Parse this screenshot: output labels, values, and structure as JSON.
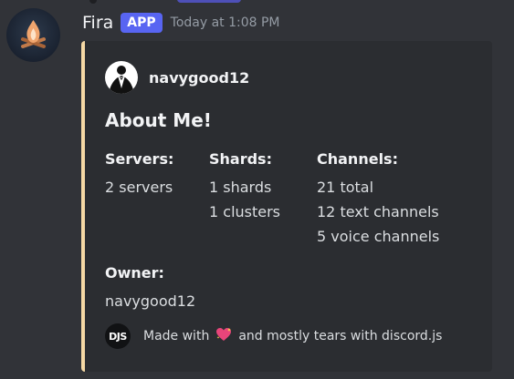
{
  "message": {
    "username": "Fira",
    "badge": "APP",
    "timestamp": "Today at 1:08 PM",
    "avatar_icon": "campfire-icon"
  },
  "embed": {
    "accent_color": "#f6d9a5",
    "author": {
      "name": "navygood12",
      "icon": "tuxedo-avatar-icon"
    },
    "title": "About Me!",
    "fields": {
      "servers": {
        "name": "Servers:",
        "lines": [
          "2 servers"
        ]
      },
      "shards": {
        "name": "Shards:",
        "lines": [
          "1 shards",
          "1 clusters"
        ]
      },
      "channels": {
        "name": "Channels:",
        "lines": [
          "21 total",
          "12 text channels",
          "5 voice channels"
        ]
      },
      "owner": {
        "name": "Owner:",
        "lines": [
          "navygood12"
        ]
      }
    },
    "footer": {
      "icon_text": "DJS",
      "text_before": "Made with",
      "heart_icon": "sparkling-heart-icon",
      "text_after": "and mostly tears with discord.js"
    }
  },
  "colors": {
    "background": "#313338",
    "embed_background": "#2b2d31",
    "badge": "#5865f2"
  }
}
